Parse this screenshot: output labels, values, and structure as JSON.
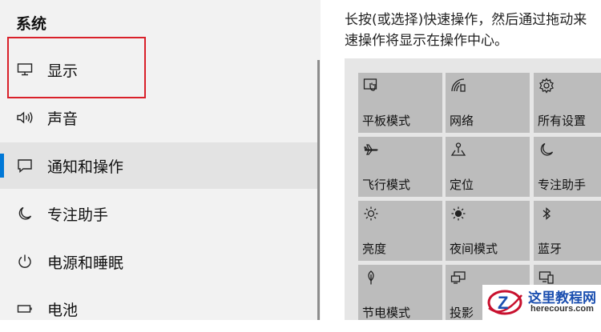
{
  "sidebar": {
    "title": "系统",
    "items": [
      {
        "label": "显示",
        "icon": "monitor-icon"
      },
      {
        "label": "声音",
        "icon": "speaker-icon"
      },
      {
        "label": "通知和操作",
        "icon": "notification-icon",
        "selected": true
      },
      {
        "label": "专注助手",
        "icon": "moon-icon"
      },
      {
        "label": "电源和睡眠",
        "icon": "power-icon"
      },
      {
        "label": "电池",
        "icon": "battery-icon"
      }
    ]
  },
  "main": {
    "description_line1": "长按(或选择)快速操作，然后通过拖动来",
    "description_line2": "速操作将显示在操作中心。",
    "tiles": [
      {
        "label": "平板模式",
        "icon": "tablet-mode-icon"
      },
      {
        "label": "网络",
        "icon": "network-icon"
      },
      {
        "label": "所有设置",
        "icon": "gear-icon"
      },
      {
        "label": "飞行模式",
        "icon": "airplane-icon"
      },
      {
        "label": "定位",
        "icon": "location-icon"
      },
      {
        "label": "专注助手",
        "icon": "moon-icon"
      },
      {
        "label": "亮度",
        "icon": "brightness-icon"
      },
      {
        "label": "夜间模式",
        "icon": "night-light-icon"
      },
      {
        "label": "蓝牙",
        "icon": "bluetooth-icon"
      },
      {
        "label": "节电模式",
        "icon": "leaf-icon"
      },
      {
        "label": "投影",
        "icon": "project-icon"
      },
      {
        "label": "",
        "icon": "connect-icon"
      }
    ]
  },
  "watermark": {
    "logo_letter": "Z",
    "title": "这里教程网",
    "url": "herecours.com"
  },
  "colors": {
    "accent": "#0078d7",
    "highlight_box": "#d9202a",
    "tile": "#bcbcbc",
    "sidebar_bg": "#f2f2f2"
  }
}
